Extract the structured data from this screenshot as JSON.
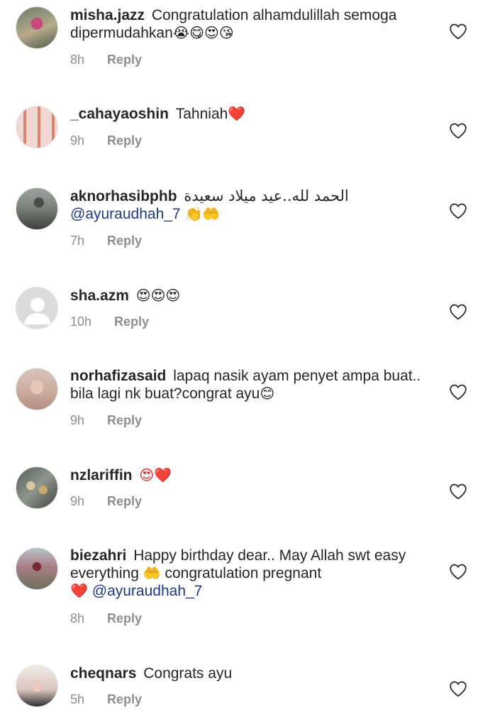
{
  "comments": [
    {
      "username": "misha.jazz",
      "text": "Congratulation alhamdulillah semoga dipermudahkan",
      "emojis": "😭😋😍😘",
      "time": "8h",
      "reply_label": "Reply"
    },
    {
      "username": "_cahayaoshin",
      "text": "Tahniah",
      "emojis": "❤️",
      "time": "9h",
      "reply_label": "Reply"
    },
    {
      "username": "aknorhasibphb",
      "text": "الحمد لله..عيد ميلاد سعيدة",
      "mention": "@ayuraudhah_7",
      "emojis": "👏🤲",
      "time": "7h",
      "reply_label": "Reply"
    },
    {
      "username": "sha.azm",
      "text": "",
      "emojis": "😍😍😍",
      "time": "10h",
      "reply_label": "Reply"
    },
    {
      "username": "norhafizasaid",
      "text": "lapaq nasik ayam penyet ampa buat.. bila lagi nk buat?congrat ayu",
      "emojis": "😊",
      "time": "9h",
      "reply_label": "Reply"
    },
    {
      "username": "nzlariffin",
      "text": "",
      "emojis": "😍❤️",
      "time": "9h",
      "reply_label": "Reply"
    },
    {
      "username": "biezahri",
      "text": "Happy birthday dear.. May Allah swt easy everything",
      "emoji_mid": "🤲",
      "text_after": "congratulation pregnant",
      "emojis": "❤️",
      "mention": "@ayuraudhah_7",
      "time": "8h",
      "reply_label": "Reply"
    },
    {
      "username": "cheqnars",
      "text": "Congrats ayu",
      "emojis": "",
      "time": "5h",
      "reply_label": "Reply"
    }
  ],
  "icons": {
    "like": "heart-outline-icon"
  },
  "colors": {
    "username": "#262626",
    "meta": "#8e8e8e",
    "mention": "#1f3a8a",
    "heart": "#e0202e"
  }
}
